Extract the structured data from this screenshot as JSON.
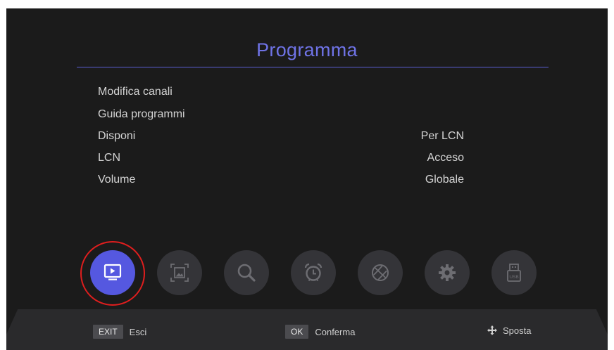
{
  "header": {
    "title": "Programma"
  },
  "menu": [
    {
      "label": "Modifica canali",
      "value": ""
    },
    {
      "label": "Guida programmi",
      "value": ""
    },
    {
      "label": "Disponi",
      "value": "Per LCN"
    },
    {
      "label": "LCN",
      "value": "Acceso"
    },
    {
      "label": "Volume",
      "value": "Globale"
    }
  ],
  "icon_bar": {
    "active_index": 0,
    "icons": [
      "tv-program-icon",
      "picture-icon",
      "search-icon",
      "alarm-clock-icon",
      "network-globe-icon",
      "settings-gear-icon",
      "usb-icon"
    ],
    "usb_label": "USB"
  },
  "footer": {
    "exit_key": "EXIT",
    "exit_label": "Esci",
    "ok_key": "OK",
    "ok_label": "Conferma",
    "move_label": "Sposta"
  },
  "colors": {
    "accent": "#5558e0",
    "title": "#6f73e6",
    "highlight": "#e01e1e",
    "background": "#1b1b1b"
  }
}
